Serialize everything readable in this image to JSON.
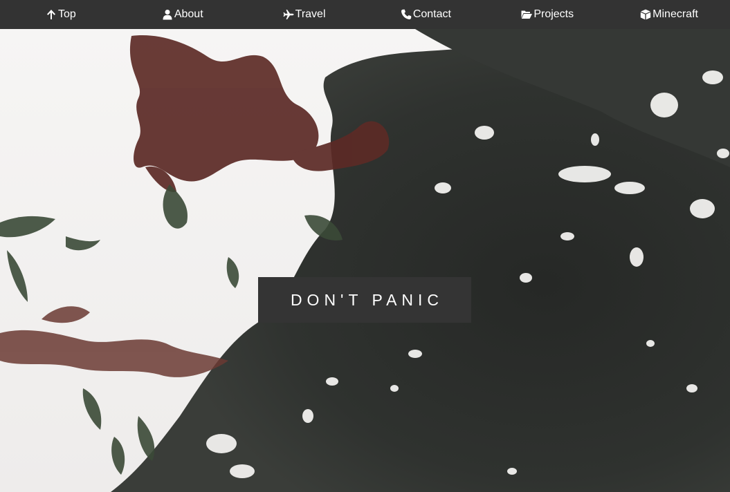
{
  "nav": {
    "items": [
      {
        "label": "Top",
        "icon": "arrow-up-icon"
      },
      {
        "label": "About",
        "icon": "user-icon"
      },
      {
        "label": "Travel",
        "icon": "plane-icon"
      },
      {
        "label": "Contact",
        "icon": "phone-icon"
      },
      {
        "label": "Projects",
        "icon": "folder-open-icon"
      },
      {
        "label": "Minecraft",
        "icon": "cube-icon"
      }
    ]
  },
  "hero": {
    "caption": "DON'T PANIC"
  },
  "colors": {
    "navbar": "#333333",
    "caption_bg": "#343434",
    "text": "#ffffff"
  }
}
